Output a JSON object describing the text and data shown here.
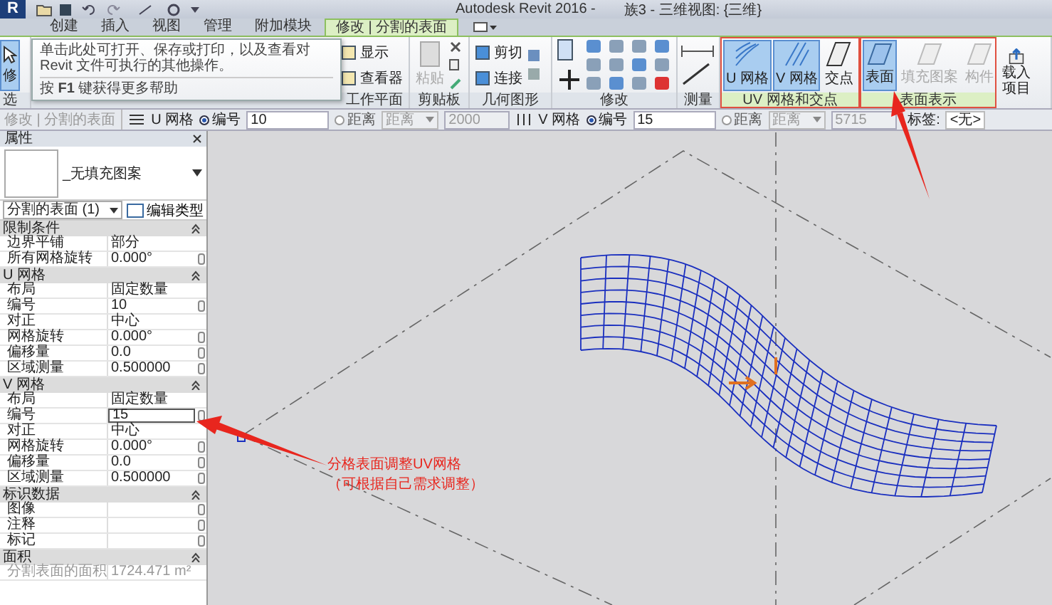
{
  "window": {
    "logo": "R",
    "title": "Autodesk Revit 2016 -",
    "document": "族3 - 三维视图: {三维}"
  },
  "tabs": [
    {
      "label": "创建",
      "selected": false
    },
    {
      "label": "插入",
      "selected": false
    },
    {
      "label": "视图",
      "selected": false
    },
    {
      "label": "管理",
      "selected": false
    },
    {
      "label": "附加模块",
      "selected": false
    },
    {
      "label": "修改 | 分割的表面",
      "selected": true
    }
  ],
  "ribbon": {
    "panels": [
      {
        "kind": "select",
        "label": "选",
        "highlighted": false,
        "tools": [
          {
            "label": "修",
            "selected": true,
            "disabled": false
          }
        ]
      },
      {
        "kind": "workplane",
        "label": "工作平面",
        "highlighted": false,
        "tools": [
          {
            "label": "显示",
            "selected": false,
            "disabled": false
          },
          {
            "label": "查看器",
            "selected": false,
            "disabled": false
          }
        ]
      },
      {
        "kind": "clipboard",
        "label": "剪贴板",
        "highlighted": false,
        "tools": [
          {
            "label": "粘贴",
            "selected": false,
            "disabled": true
          }
        ]
      },
      {
        "kind": "geometry",
        "label": "几何图形",
        "highlighted": false,
        "tools": [
          {
            "label": "剪切",
            "selected": false,
            "disabled": false
          },
          {
            "label": "连接",
            "selected": false,
            "disabled": false
          }
        ]
      },
      {
        "kind": "modify",
        "label": "修改",
        "highlighted": false
      },
      {
        "kind": "measure",
        "label": "测量",
        "highlighted": false
      },
      {
        "kind": "uv",
        "label": "UV 网格和交点",
        "highlighted": true,
        "tools": [
          {
            "label": "U 网格",
            "selected": true,
            "disabled": false
          },
          {
            "label": "V 网格",
            "selected": true,
            "disabled": false
          },
          {
            "label": "交点",
            "selected": false,
            "disabled": false
          }
        ]
      },
      {
        "kind": "surface",
        "label": "表面表示",
        "highlighted": true,
        "tools": [
          {
            "label": "表面",
            "selected": true,
            "disabled": false
          },
          {
            "label": "填充图案",
            "selected": false,
            "disabled": true
          },
          {
            "label": "构件",
            "selected": false,
            "disabled": true
          }
        ]
      },
      {
        "kind": "load",
        "highlighted": false,
        "tools": [
          {
            "label": "载入项目",
            "selected": false,
            "disabled": false
          }
        ]
      }
    ]
  },
  "tooltip": {
    "text": "单击此处可打开、保存或打印，以及查看对 Revit 文件可执行的其他操作。",
    "help": "按 **F1** 键获得更多帮助"
  },
  "options_bar": {
    "context": "修改 | 分割的表面",
    "groups": [
      {
        "label": "U 网格",
        "options": [
          {
            "label": "编号",
            "selected": true
          },
          {
            "label": "距离",
            "selected": false
          }
        ],
        "number": "10",
        "distance_type": "距离",
        "distance": "2000"
      },
      {
        "label": "V 网格",
        "options": [
          {
            "label": "编号",
            "selected": true
          },
          {
            "label": "距离",
            "selected": false
          }
        ],
        "number": "15",
        "distance_type": "距离",
        "distance": "5715"
      }
    ],
    "tag_label": "标签:",
    "tag_value": "<无>"
  },
  "properties": {
    "title": "属性",
    "type_name": "_无填充图案",
    "selector": "分割的表面 (1)",
    "edit_type": "编辑类型",
    "sections": [
      {
        "title": "限制条件",
        "rows": [
          {
            "label": "边界平铺",
            "value": "部分",
            "button": false,
            "selected": false,
            "disabled": false
          },
          {
            "label": "所有网格旋转",
            "value": "0.000°",
            "button": true,
            "selected": false,
            "disabled": false
          }
        ]
      },
      {
        "title": "U 网格",
        "rows": [
          {
            "label": "布局",
            "value": "固定数量",
            "button": false,
            "selected": false,
            "disabled": false
          },
          {
            "label": "编号",
            "value": "10",
            "button": true,
            "selected": false,
            "disabled": false
          },
          {
            "label": "对正",
            "value": "中心",
            "button": false,
            "selected": false,
            "disabled": false
          },
          {
            "label": "网格旋转",
            "value": "0.000°",
            "button": true,
            "selected": false,
            "disabled": false
          },
          {
            "label": "偏移量",
            "value": "0.0",
            "button": true,
            "selected": false,
            "disabled": false
          },
          {
            "label": "区域测量",
            "value": "0.500000",
            "button": true,
            "selected": false,
            "disabled": false
          }
        ]
      },
      {
        "title": "V 网格",
        "rows": [
          {
            "label": "布局",
            "value": "固定数量",
            "button": false,
            "selected": false,
            "disabled": false
          },
          {
            "label": "编号",
            "value": "15",
            "button": true,
            "selected": true,
            "disabled": false
          },
          {
            "label": "对正",
            "value": "中心",
            "button": false,
            "selected": false,
            "disabled": false
          },
          {
            "label": "网格旋转",
            "value": "0.000°",
            "button": true,
            "selected": false,
            "disabled": false
          },
          {
            "label": "偏移量",
            "value": "0.0",
            "button": true,
            "selected": false,
            "disabled": false
          },
          {
            "label": "区域测量",
            "value": "0.500000",
            "button": true,
            "selected": false,
            "disabled": false
          }
        ]
      },
      {
        "title": "标识数据",
        "rows": [
          {
            "label": "图像",
            "button": true,
            "selected": false,
            "disabled": false
          },
          {
            "label": "注释",
            "button": true,
            "selected": false,
            "disabled": false
          },
          {
            "label": "标记",
            "button": true,
            "selected": false,
            "disabled": false
          }
        ]
      },
      {
        "title": "面积",
        "rows": [
          {
            "label": "分割表面的面积",
            "value": "1724.471 m²",
            "button": false,
            "selected": false,
            "disabled": true
          }
        ]
      }
    ]
  },
  "canvas": {
    "note_lines": [
      "分格表面调整UV网格",
      "（可根据自己需求调整）"
    ]
  }
}
